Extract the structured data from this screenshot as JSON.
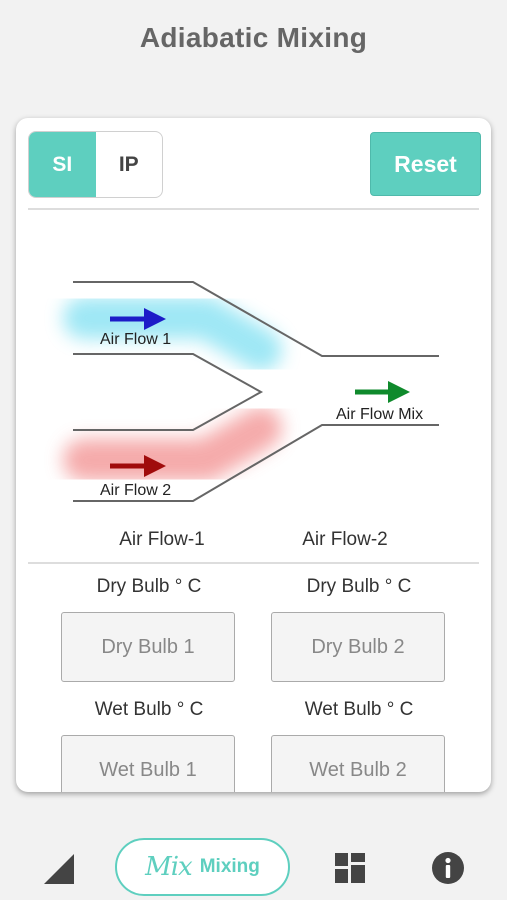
{
  "header": {
    "title": "Adiabatic Mixing"
  },
  "units": {
    "options": [
      "SI",
      "IP"
    ],
    "selected": "SI"
  },
  "actions": {
    "reset_label": "Reset"
  },
  "diagram": {
    "flow1_label": "Air Flow 1",
    "flow2_label": "Air Flow 2",
    "mix_label": "Air Flow Mix",
    "flow1_color": "#1c1cc8",
    "flow2_color": "#a00c0c",
    "mix_color": "#0f8a2c"
  },
  "columns": {
    "flow1": "Air Flow-1",
    "flow2": "Air Flow-2"
  },
  "inputs": {
    "dry_bulb_label_1": "Dry Bulb ° C",
    "dry_bulb_label_2": "Dry Bulb ° C",
    "dry_bulb_1_placeholder": "Dry Bulb 1",
    "dry_bulb_2_placeholder": "Dry Bulb 2",
    "wet_bulb_label_1": "Wet Bulb ° C",
    "wet_bulb_label_2": "Wet Bulb ° C",
    "wet_bulb_1_placeholder": "Wet Bulb 1",
    "wet_bulb_2_placeholder": "Wet Bulb 2"
  },
  "tabbar": {
    "items": [
      {
        "icon": "chart-icon"
      },
      {
        "icon": "mix-icon",
        "logo": "Mix",
        "label": "Mixing",
        "active": true
      },
      {
        "icon": "grid-icon"
      },
      {
        "icon": "info-icon"
      }
    ]
  },
  "colors": {
    "accent": "#5ecfbf"
  }
}
